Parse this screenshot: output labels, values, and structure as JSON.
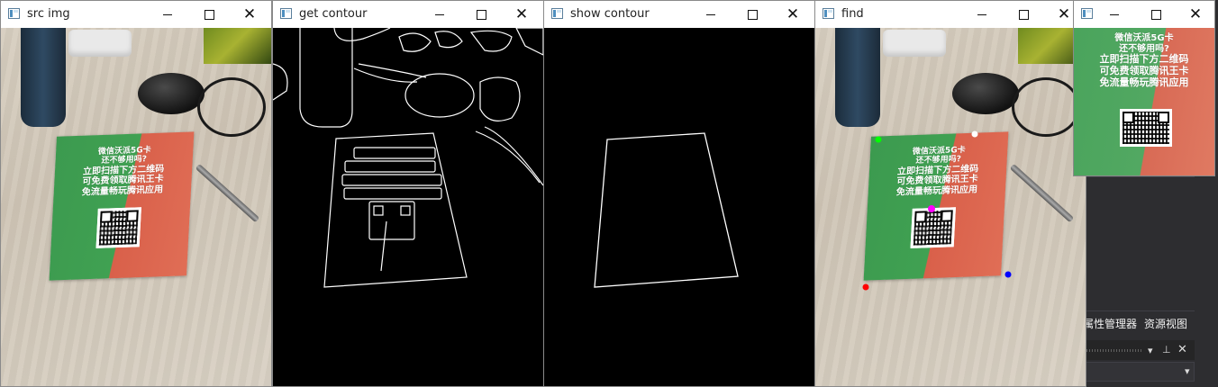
{
  "windows": [
    {
      "id": "src",
      "title": "src img"
    },
    {
      "id": "get",
      "title": "get contour"
    },
    {
      "id": "show",
      "title": "show contour"
    },
    {
      "id": "find",
      "title": "find"
    },
    {
      "id": "warp",
      "title": ""
    }
  ],
  "flyer": {
    "lines": [
      "微信沃派5G卡",
      "还不够用吗?",
      "立即扫描下方二维码",
      "可免费领取腾讯王卡",
      "免流量畅玩腾讯应用"
    ]
  },
  "corner_markers": [
    {
      "name": "top-left",
      "color": "#00ff00"
    },
    {
      "name": "top-right",
      "color": "#ffffff"
    },
    {
      "name": "bottom-left",
      "color": "#ff0000"
    },
    {
      "name": "bottom-right",
      "color": "#0000ff"
    },
    {
      "name": "center",
      "color": "#ff00ff"
    }
  ],
  "vs_panel": {
    "tabs": [
      "属性管理器",
      "资源视图"
    ],
    "pin_icon": "pin-icon",
    "close_icon": "close-icon",
    "dropdown_icon": "dropdown-arrow-icon"
  },
  "colors": {
    "contour": "#ffffff",
    "canvas": "#000000",
    "vs_background": "#2d2d30"
  }
}
